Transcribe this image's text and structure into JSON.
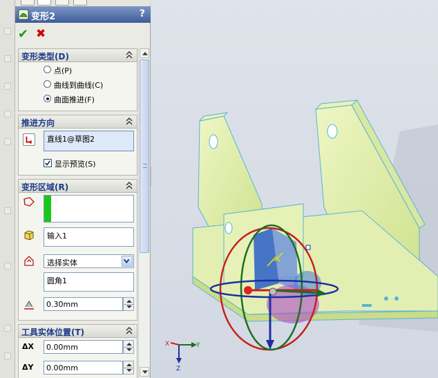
{
  "panel": {
    "title": "变形2",
    "help": "?"
  },
  "groups": {
    "deform_type": {
      "title": "变形类型(D)",
      "options": [
        "点(P)",
        "曲线到曲线(C)",
        "曲面推进(F)"
      ],
      "selected": "曲面推进(F)"
    },
    "push_dir": {
      "title": "推进方向",
      "value": "直线1@草图2",
      "show_preview_label": "显示预览(S)",
      "show_preview_checked": true
    },
    "deform_region": {
      "title": "变形区域(R)",
      "input_value": "输入1",
      "select_value": "选择实体",
      "entity_value": "圆角1",
      "distance": "0.30mm"
    },
    "tool_pos": {
      "title": "工具实体位置(T)",
      "dx_label": "ΔX",
      "dx": "0.00mm",
      "dy_label": "ΔY",
      "dy": "0.00mm"
    }
  },
  "triad": {
    "x": "X",
    "y": "Y",
    "z": "Z"
  },
  "colors": {
    "title_bar": "#3d5c9a",
    "group_title": "#1b3a8a",
    "model_fill": "#dfeea8",
    "model_edge": "#59b3d6",
    "ring_red": "#c81e1e",
    "ring_green": "#1e6e1e",
    "ring_blue": "#1e2ea0"
  }
}
